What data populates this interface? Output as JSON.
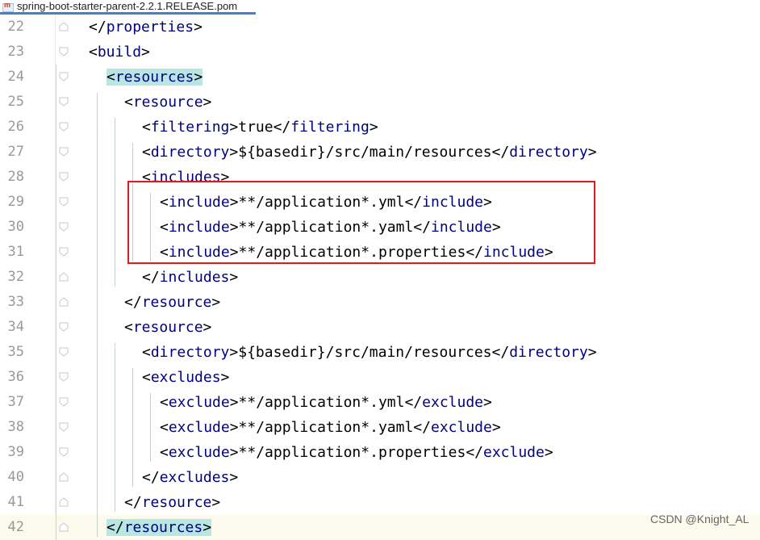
{
  "tab": {
    "filename": "spring-boot-starter-parent-2.2.1.RELEASE.pom",
    "icon": "maven-pom-file-icon"
  },
  "lines": [
    {
      "num": "22",
      "indent": 0,
      "parts": [
        [
          "b",
          "</"
        ],
        [
          "t",
          "properties"
        ],
        [
          "b",
          ">"
        ]
      ]
    },
    {
      "num": "23",
      "indent": 0,
      "parts": [
        [
          "b",
          "<"
        ],
        [
          "t",
          "build"
        ],
        [
          "b",
          ">"
        ]
      ]
    },
    {
      "num": "24",
      "indent": 1,
      "highlight": true,
      "parts": [
        [
          "b",
          "<"
        ],
        [
          "t",
          "resources"
        ],
        [
          "b",
          ">"
        ]
      ]
    },
    {
      "num": "25",
      "indent": 2,
      "parts": [
        [
          "b",
          "<"
        ],
        [
          "t",
          "resource"
        ],
        [
          "b",
          ">"
        ]
      ]
    },
    {
      "num": "26",
      "indent": 3,
      "parts": [
        [
          "b",
          "<"
        ],
        [
          "t",
          "filtering"
        ],
        [
          "b",
          ">"
        ],
        [
          "x",
          "true"
        ],
        [
          "b",
          "</"
        ],
        [
          "t",
          "filtering"
        ],
        [
          "b",
          ">"
        ]
      ]
    },
    {
      "num": "27",
      "indent": 3,
      "parts": [
        [
          "b",
          "<"
        ],
        [
          "t",
          "directory"
        ],
        [
          "b",
          ">"
        ],
        [
          "x",
          "${basedir}/src/main/resources"
        ],
        [
          "b",
          "</"
        ],
        [
          "t",
          "directory"
        ],
        [
          "b",
          ">"
        ]
      ]
    },
    {
      "num": "28",
      "indent": 3,
      "parts": [
        [
          "b",
          "<"
        ],
        [
          "t",
          "includes"
        ],
        [
          "b",
          ">"
        ]
      ]
    },
    {
      "num": "29",
      "indent": 4,
      "parts": [
        [
          "b",
          "<"
        ],
        [
          "t",
          "include"
        ],
        [
          "b",
          ">"
        ],
        [
          "x",
          "**/application*.yml"
        ],
        [
          "b",
          "</"
        ],
        [
          "t",
          "include"
        ],
        [
          "b",
          ">"
        ]
      ]
    },
    {
      "num": "30",
      "indent": 4,
      "parts": [
        [
          "b",
          "<"
        ],
        [
          "t",
          "include"
        ],
        [
          "b",
          ">"
        ],
        [
          "x",
          "**/application*.yaml"
        ],
        [
          "b",
          "</"
        ],
        [
          "t",
          "include"
        ],
        [
          "b",
          ">"
        ]
      ]
    },
    {
      "num": "31",
      "indent": 4,
      "parts": [
        [
          "b",
          "<"
        ],
        [
          "t",
          "include"
        ],
        [
          "b",
          ">"
        ],
        [
          "x",
          "**/application*.properties"
        ],
        [
          "b",
          "</"
        ],
        [
          "t",
          "include"
        ],
        [
          "b",
          ">"
        ]
      ]
    },
    {
      "num": "32",
      "indent": 3,
      "parts": [
        [
          "b",
          "</"
        ],
        [
          "t",
          "includes"
        ],
        [
          "b",
          ">"
        ]
      ]
    },
    {
      "num": "33",
      "indent": 2,
      "parts": [
        [
          "b",
          "</"
        ],
        [
          "t",
          "resource"
        ],
        [
          "b",
          ">"
        ]
      ]
    },
    {
      "num": "34",
      "indent": 2,
      "parts": [
        [
          "b",
          "<"
        ],
        [
          "t",
          "resource"
        ],
        [
          "b",
          ">"
        ]
      ]
    },
    {
      "num": "35",
      "indent": 3,
      "parts": [
        [
          "b",
          "<"
        ],
        [
          "t",
          "directory"
        ],
        [
          "b",
          ">"
        ],
        [
          "x",
          "${basedir}/src/main/resources"
        ],
        [
          "b",
          "</"
        ],
        [
          "t",
          "directory"
        ],
        [
          "b",
          ">"
        ]
      ]
    },
    {
      "num": "36",
      "indent": 3,
      "parts": [
        [
          "b",
          "<"
        ],
        [
          "t",
          "excludes"
        ],
        [
          "b",
          ">"
        ]
      ]
    },
    {
      "num": "37",
      "indent": 4,
      "parts": [
        [
          "b",
          "<"
        ],
        [
          "t",
          "exclude"
        ],
        [
          "b",
          ">"
        ],
        [
          "x",
          "**/application*.yml"
        ],
        [
          "b",
          "</"
        ],
        [
          "t",
          "exclude"
        ],
        [
          "b",
          ">"
        ]
      ]
    },
    {
      "num": "38",
      "indent": 4,
      "parts": [
        [
          "b",
          "<"
        ],
        [
          "t",
          "exclude"
        ],
        [
          "b",
          ">"
        ],
        [
          "x",
          "**/application*.yaml"
        ],
        [
          "b",
          "</"
        ],
        [
          "t",
          "exclude"
        ],
        [
          "b",
          ">"
        ]
      ]
    },
    {
      "num": "39",
      "indent": 4,
      "parts": [
        [
          "b",
          "<"
        ],
        [
          "t",
          "exclude"
        ],
        [
          "b",
          ">"
        ],
        [
          "x",
          "**/application*.properties"
        ],
        [
          "b",
          "</"
        ],
        [
          "t",
          "exclude"
        ],
        [
          "b",
          ">"
        ]
      ]
    },
    {
      "num": "40",
      "indent": 3,
      "parts": [
        [
          "b",
          "</"
        ],
        [
          "t",
          "excludes"
        ],
        [
          "b",
          ">"
        ]
      ]
    },
    {
      "num": "41",
      "indent": 2,
      "parts": [
        [
          "b",
          "</"
        ],
        [
          "t",
          "resource"
        ],
        [
          "b",
          ">"
        ]
      ]
    },
    {
      "num": "42",
      "indent": 1,
      "highlight": true,
      "caret": true,
      "parts": [
        [
          "b",
          "</"
        ],
        [
          "t",
          "resources"
        ],
        [
          "b",
          ">"
        ]
      ]
    }
  ],
  "colors": {
    "tag": "#000080",
    "text": "#000000",
    "highlight": "#b8e6e2",
    "annotation_box": "#e11b1b",
    "line_numbers": "#999999"
  },
  "watermark": "CSDN @Knight_AL"
}
